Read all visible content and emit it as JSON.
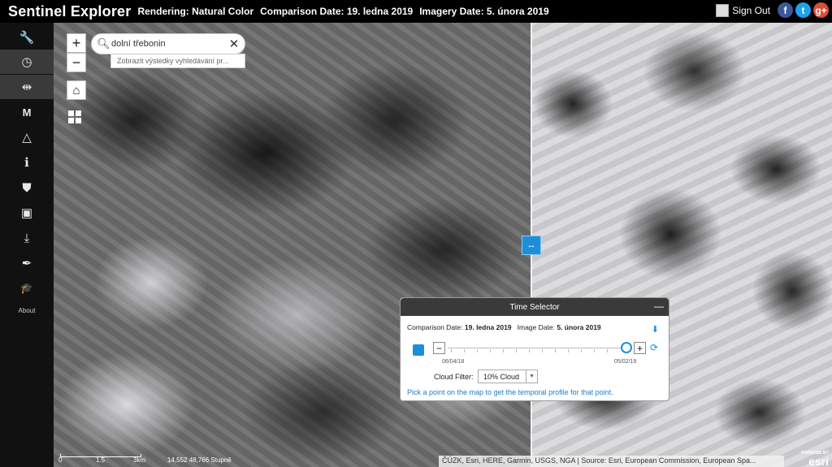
{
  "header": {
    "app_title": "Sentinel Explorer",
    "rendering": "Rendering: Natural Color",
    "comparison_date": "Comparison Date: 19. ledna 2019",
    "imagery_date": "Imagery Date: 5. února 2019",
    "sign_out": "Sign Out",
    "social": {
      "facebook": "f",
      "twitter": "t",
      "google": "g+"
    }
  },
  "toolbar": {
    "items": [
      {
        "name": "tools",
        "icon": "wrench-icon",
        "glyph": "🔧"
      },
      {
        "name": "time",
        "icon": "clock-icon",
        "glyph": "◷"
      },
      {
        "name": "swipe",
        "icon": "swipe-icon",
        "glyph": "⇹"
      },
      {
        "name": "measure",
        "icon": "measure-icon",
        "glyph": "M"
      },
      {
        "name": "change",
        "icon": "triangle-icon",
        "glyph": "△"
      },
      {
        "name": "info",
        "icon": "info-icon",
        "glyph": "ℹ"
      },
      {
        "name": "bookmark",
        "icon": "bookmark-icon",
        "glyph": "⛊"
      },
      {
        "name": "save",
        "icon": "save-icon",
        "glyph": "▣"
      },
      {
        "name": "export",
        "icon": "download-icon",
        "glyph": "⤓"
      },
      {
        "name": "annotate",
        "icon": "feather-icon",
        "glyph": "✒"
      },
      {
        "name": "about",
        "icon": "graduation-cap-icon",
        "glyph": "🎓"
      }
    ],
    "about_label": "About"
  },
  "map": {
    "zoom_in": "+",
    "zoom_out": "−",
    "home": "⌂",
    "search_value": "dolní třebonin",
    "search_suggestion": "Zobrazit výsledky vyhledávání pr...",
    "swipe_handle": "↔",
    "scale": {
      "zero": "0",
      "mid": "1.5",
      "end": "3km"
    },
    "coordinates": "14,552 48,766 Stupně",
    "attribution": "ČÚZK, Esri, HERE, Garmin, USGS, NGA | Source: Esri, European Commission, European Spa...",
    "esri_small": "POWERED BY",
    "esri": "esri"
  },
  "time_selector": {
    "title": "Time Selector",
    "minimize": "—",
    "comparison_label": "Comparison Date:",
    "comparison_value": "19. ledna 2019",
    "image_label": "Image Date:",
    "image_value": "5. února 2019",
    "range_start": "06/04/18",
    "range_end": "05/02/19",
    "cloud_filter_label": "Cloud Filter:",
    "cloud_filter_value": "10% Cloud",
    "hint": "Pick a point on the map to get the temporal profile for that point."
  }
}
